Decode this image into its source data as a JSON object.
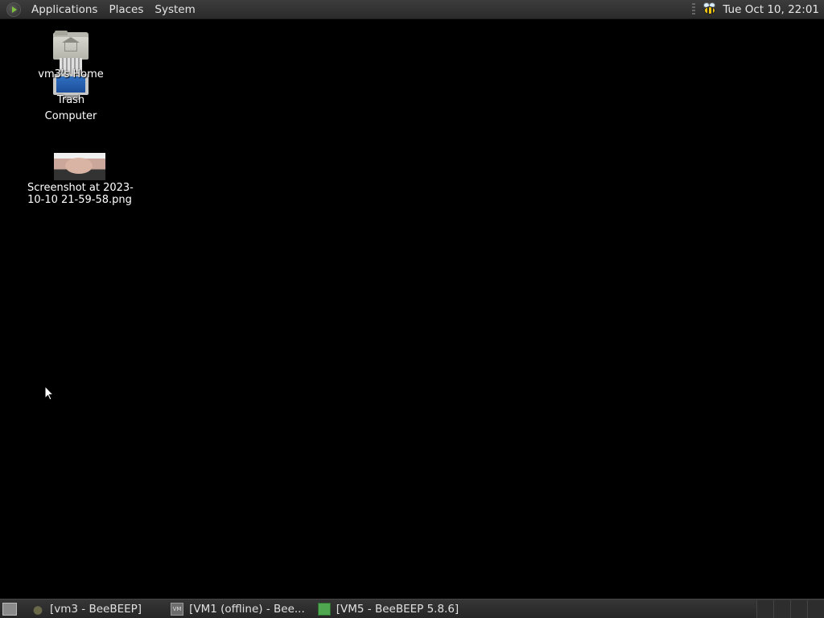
{
  "top_panel": {
    "menus": [
      "Applications",
      "Places",
      "System"
    ],
    "clock": "Tue Oct 10, 22:01",
    "tray_icon": "beebeep-icon"
  },
  "desktop": {
    "icons": [
      {
        "label": "vm3's Home",
        "icon": "home-folder-icon"
      },
      {
        "label": "Trash",
        "icon": "trash-icon"
      },
      {
        "label": "Computer",
        "icon": "computer-icon"
      },
      {
        "label_line1": "Screenshot at 2023-",
        "label_line2": "10-10 21-59-58.png",
        "icon": "image-thumbnail"
      }
    ]
  },
  "bottom_panel": {
    "tasks": [
      {
        "label": "[vm3 - BeeBEEP]",
        "icon": "beebeep-icon"
      },
      {
        "label": "[VM1 (offline) - Bee...",
        "icon": "vm-icon",
        "icon_text": "VM"
      },
      {
        "label": "[VM5 - BeeBEEP 5.8.6]",
        "icon": "green-window-icon"
      }
    ]
  },
  "colors": {
    "desktop_bg": "#000000",
    "panel_bg": "#2b2b2b",
    "text": "#dcdcdc"
  }
}
